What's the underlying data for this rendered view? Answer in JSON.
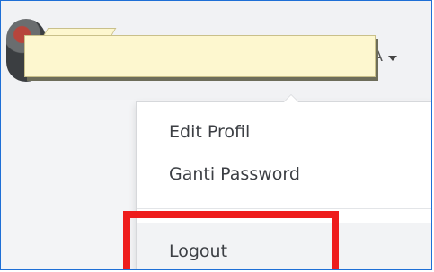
{
  "header": {
    "user_initial": "A"
  },
  "dropdown": {
    "items": [
      {
        "label": "Edit Profil"
      },
      {
        "label": "Ganti Password"
      },
      {
        "label": "Logout"
      }
    ]
  },
  "annotation": {
    "highlight_color": "#ee1c1c",
    "highlighted_item": "Logout"
  }
}
